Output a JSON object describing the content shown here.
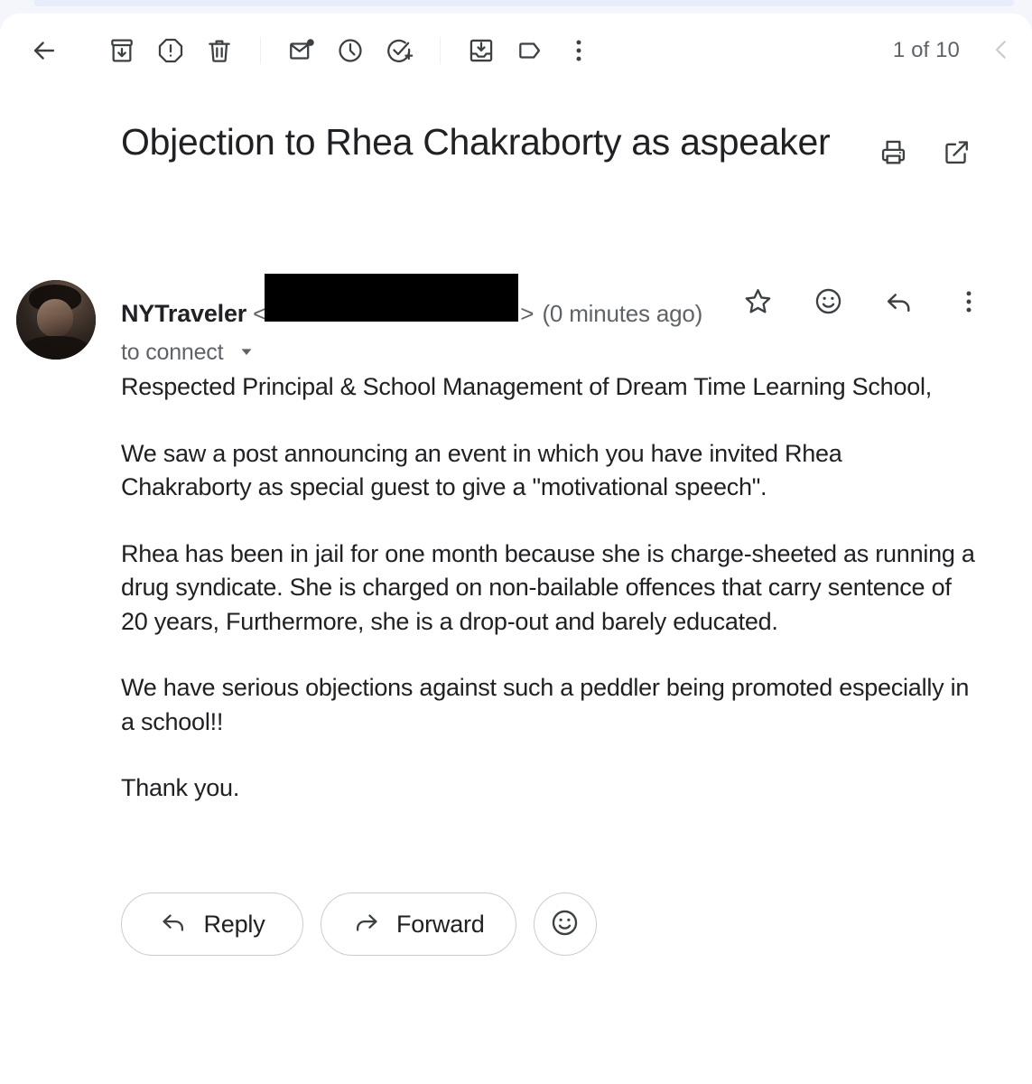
{
  "toolbar": {
    "back_label": "Back",
    "icons": [
      {
        "name": "back-arrow-icon",
        "label": "Back"
      },
      {
        "name": "archive-icon",
        "label": "Archive"
      },
      {
        "name": "report-spam-icon",
        "label": "Report spam"
      },
      {
        "name": "delete-icon",
        "label": "Delete"
      },
      {
        "name": "mark-unread-icon",
        "label": "Mark as unread"
      },
      {
        "name": "snooze-clock-icon",
        "label": "Snooze"
      },
      {
        "name": "add-to-tasks-icon",
        "label": "Add to tasks"
      },
      {
        "name": "move-to-inbox-icon",
        "label": "Move to inbox"
      },
      {
        "name": "label-tag-icon",
        "label": "Labels"
      },
      {
        "name": "more-vertical-icon",
        "label": "More"
      }
    ],
    "counter": "1 of 10",
    "prev_label": "Newer"
  },
  "subject": {
    "title": "Objection to Rhea Chakraborty as aspeaker",
    "print_label": "Print all",
    "popout_label": "Open in new window"
  },
  "sender": {
    "name": "NYTraveler",
    "angle_open": "<",
    "email_redacted": true,
    "angle_close": ">",
    "timestamp": "(0 minutes ago)",
    "recipient": "to connect",
    "star_label": "Star",
    "react_label": "Add reaction",
    "reply_label": "Reply",
    "more_label": "More"
  },
  "body": {
    "paragraphs": [
      "Respected Principal & School Management of Dream Time Learning School,",
      "We saw a post announcing an event in which you have invited Rhea Chakraborty as special guest to give a \"motivational speech\".",
      "Rhea has been in jail for one month because she is charge-sheeted as running a drug syndicate. She is charged on non-bailable offences that carry sentence of 20 years, Furthermore, she is a drop-out and barely educated.",
      "We have serious objections against such a peddler being promoted especially in a school!!",
      "Thank you."
    ]
  },
  "actions": {
    "reply": "Reply",
    "forward": "Forward",
    "react_label": "Add reaction"
  },
  "colors": {
    "page_background": "#f4f6fb",
    "panel_background": "#ffffff",
    "text_primary": "#202124",
    "text_secondary": "#5f6368",
    "icon": "#3c4043",
    "border": "#c9ccd1",
    "redaction": "#000000"
  }
}
